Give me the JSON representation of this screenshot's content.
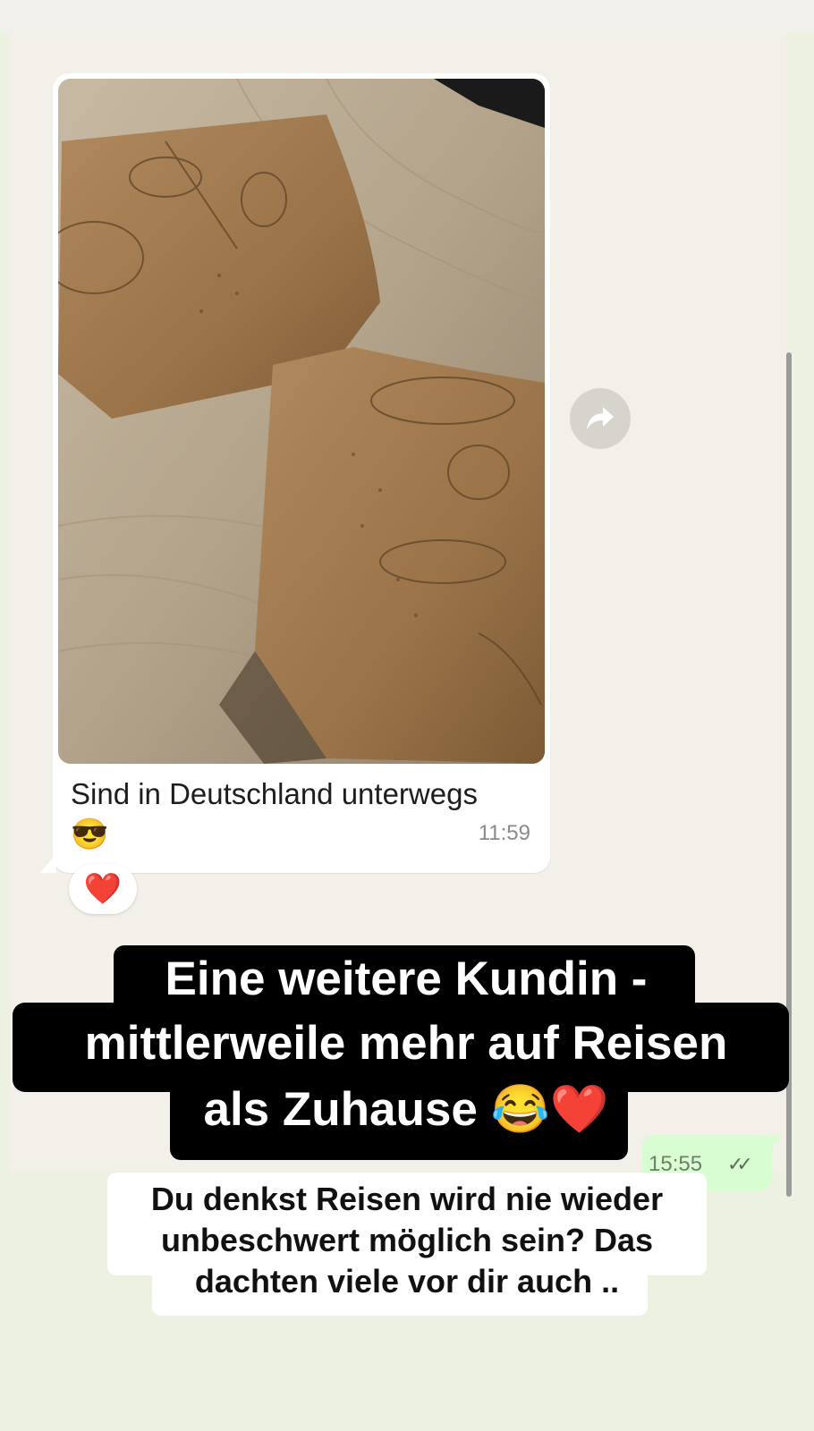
{
  "chat": {
    "message": {
      "caption": "Sind in Deutschland unterwegs",
      "caption_emoji": "😎",
      "time": "11:59",
      "reaction": "❤️",
      "image_alt": "two paper bakery bags on a wooden table"
    },
    "sent_message": {
      "time": "15:55",
      "status_icon": "double-check-icon"
    },
    "forward_icon": "forward-arrow-icon"
  },
  "overlay": {
    "headline_lines": [
      "Eine weitere Kundin -",
      "mittlerweile mehr auf Reisen",
      "als Zuhause 😂❤️"
    ],
    "subtext_lines": [
      "Du denkst Reisen wird nie wieder",
      "unbeschwert möglich sein? Das",
      "dachten viele vor dir auch .."
    ]
  },
  "colors": {
    "page_background": "#ecf1e2",
    "chat_background": "#f3efe9",
    "incoming_bubble": "#ffffff",
    "outgoing_bubble": "#d9fdd3",
    "overlay_black": "#000000"
  }
}
